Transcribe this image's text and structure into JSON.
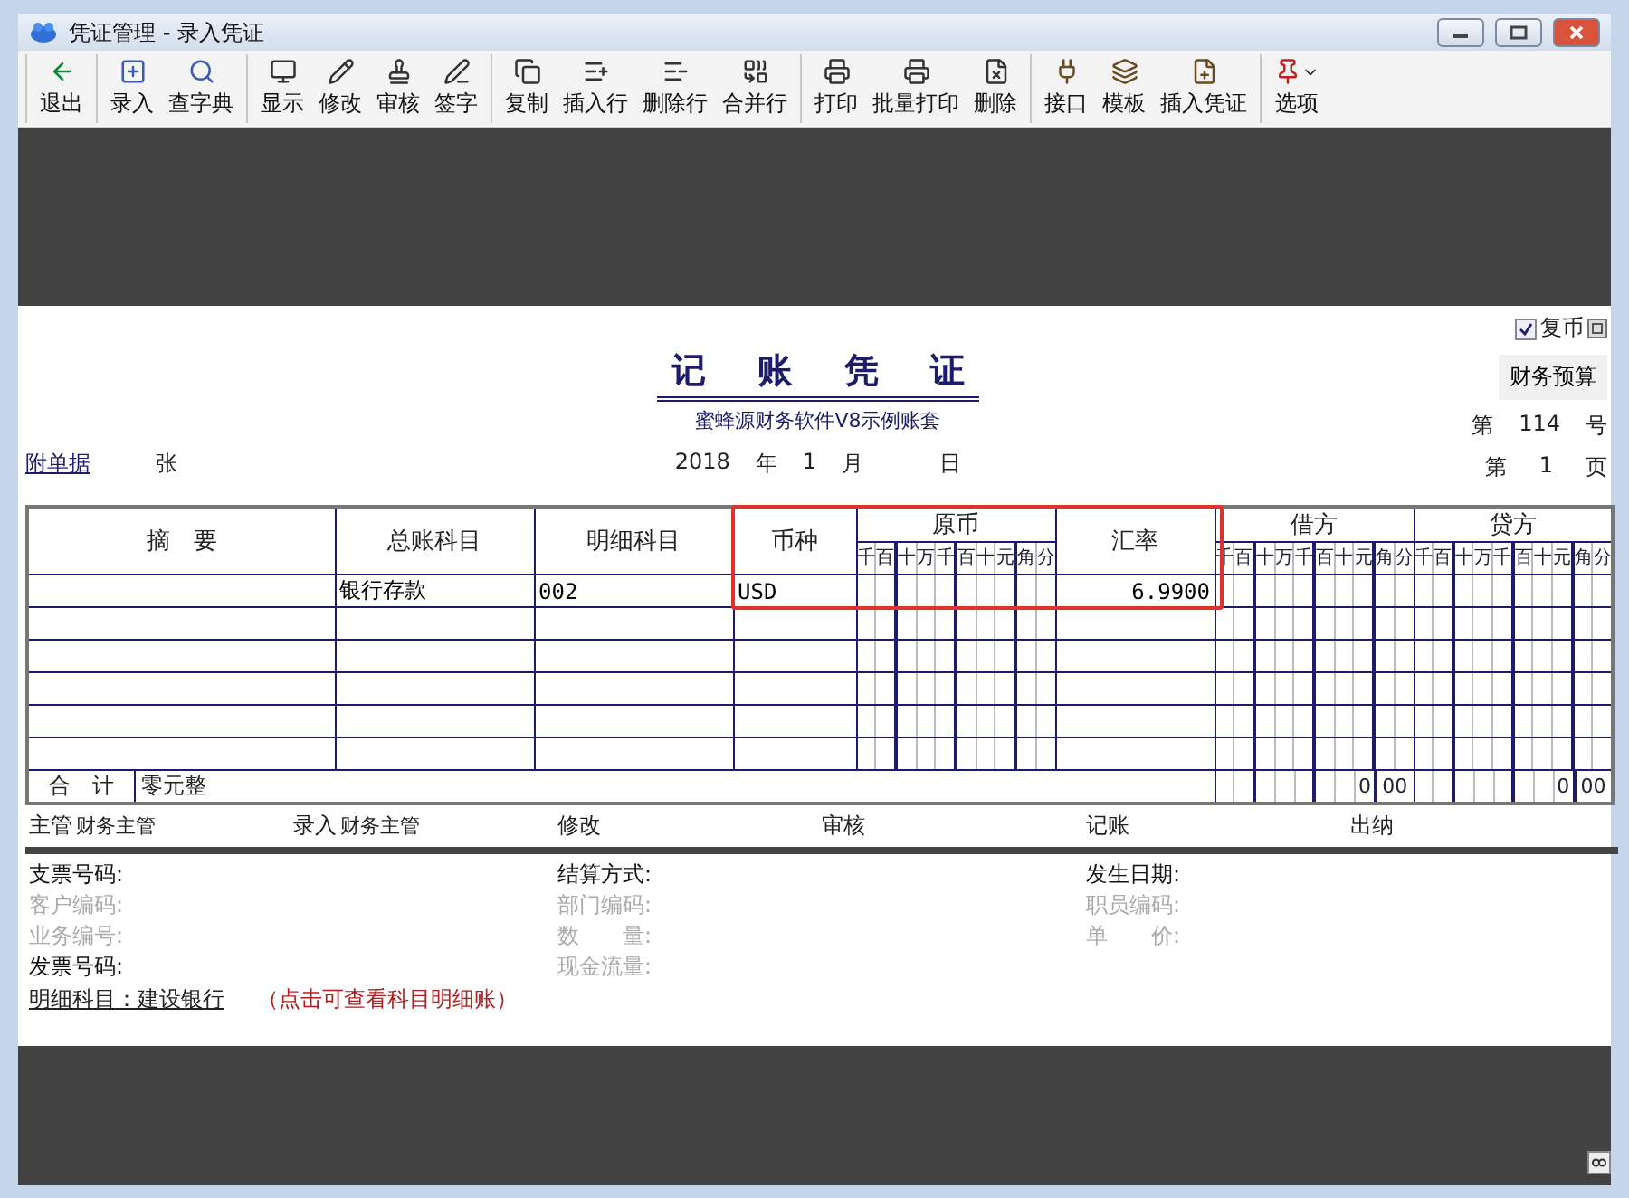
{
  "window": {
    "title": "凭证管理 - 录入凭证"
  },
  "toolbar": [
    [
      {
        "label": "退出"
      }
    ],
    [
      {
        "label": "录入"
      },
      {
        "label": "查字典"
      }
    ],
    [
      {
        "label": "显示"
      },
      {
        "label": "修改"
      },
      {
        "label": "审核"
      },
      {
        "label": "签字"
      }
    ],
    [
      {
        "label": "复制"
      },
      {
        "label": "插入行"
      },
      {
        "label": "删除行"
      },
      {
        "label": "合并行"
      }
    ],
    [
      {
        "label": "打印"
      },
      {
        "label": "批量打印"
      },
      {
        "label": "删除"
      }
    ],
    [
      {
        "label": "接口"
      },
      {
        "label": "模板"
      },
      {
        "label": "插入凭证"
      }
    ],
    [
      {
        "label": "选项",
        "dropdown": true
      }
    ]
  ],
  "voucher": {
    "dual_currency": {
      "label": "复币",
      "checked": true
    },
    "budget_button": "财务预算",
    "title": "记 账 凭 证",
    "subtitle": "蜜蜂源财务软件V8示例账套",
    "attachments_link": "附单据",
    "attachments_unit": "张",
    "year": "2018",
    "year_label": "年",
    "month": "1",
    "month_label": "月",
    "day_label": "日",
    "number_prefix": "第",
    "number": "114",
    "number_suffix": "号",
    "page_prefix": "第",
    "page": "1",
    "page_suffix": "页"
  },
  "table": {
    "columns": [
      "摘　要",
      "总账科目",
      "明细科目",
      "币种",
      "原币",
      "汇率",
      "借方",
      "贷方"
    ],
    "digit_labels": [
      [
        "千",
        "百",
        "十",
        "万",
        "千",
        "百",
        "十",
        "元",
        "角",
        "分"
      ],
      [
        "千",
        "百",
        "十",
        "万",
        "千",
        "百",
        "十",
        "元",
        "角",
        "分"
      ],
      [
        "千",
        "百",
        "十",
        "万",
        "千",
        "百",
        "十",
        "元",
        "角",
        "分"
      ]
    ],
    "rows": [
      {
        "summary": "",
        "account": "银行存款",
        "detail": "002",
        "currency": "USD",
        "rate": "6.9900"
      },
      {},
      {},
      {},
      {},
      {}
    ],
    "total_label": "合　计",
    "total_words": "零元整",
    "debit_total": {
      "yuan": "0",
      "fen": "00"
    },
    "credit_total": {
      "yuan": "0",
      "fen": "00"
    },
    "highlight": true
  },
  "signatures": [
    {
      "label": "主管",
      "value": "财务主管"
    },
    {
      "label": "录入",
      "value": "财务主管"
    },
    {
      "label": "修改"
    },
    {
      "label": "审核"
    },
    {
      "label": "记账"
    },
    {
      "label": "出纳"
    }
  ],
  "details": {
    "columns": [
      [
        {
          "label": "支票号码:",
          "disabled": false
        },
        {
          "label": "客户编码:",
          "disabled": true
        },
        {
          "label": "业务编号:",
          "disabled": true
        },
        {
          "label": "发票号码:",
          "disabled": false
        }
      ],
      [
        {
          "label": "结算方式:",
          "disabled": false
        },
        {
          "label": "部门编码:",
          "disabled": true
        },
        {
          "label": "数　　量:",
          "disabled": true
        },
        {
          "label": "现金流量:",
          "disabled": true
        }
      ],
      [
        {
          "label": "发生日期:",
          "disabled": false
        },
        {
          "label": "职员编码:",
          "disabled": true
        },
        {
          "label": "单　　价:",
          "disabled": true
        }
      ]
    ],
    "detail_link": "明细科目：建设银行",
    "hint": "（点击可查看科目明细账）"
  }
}
